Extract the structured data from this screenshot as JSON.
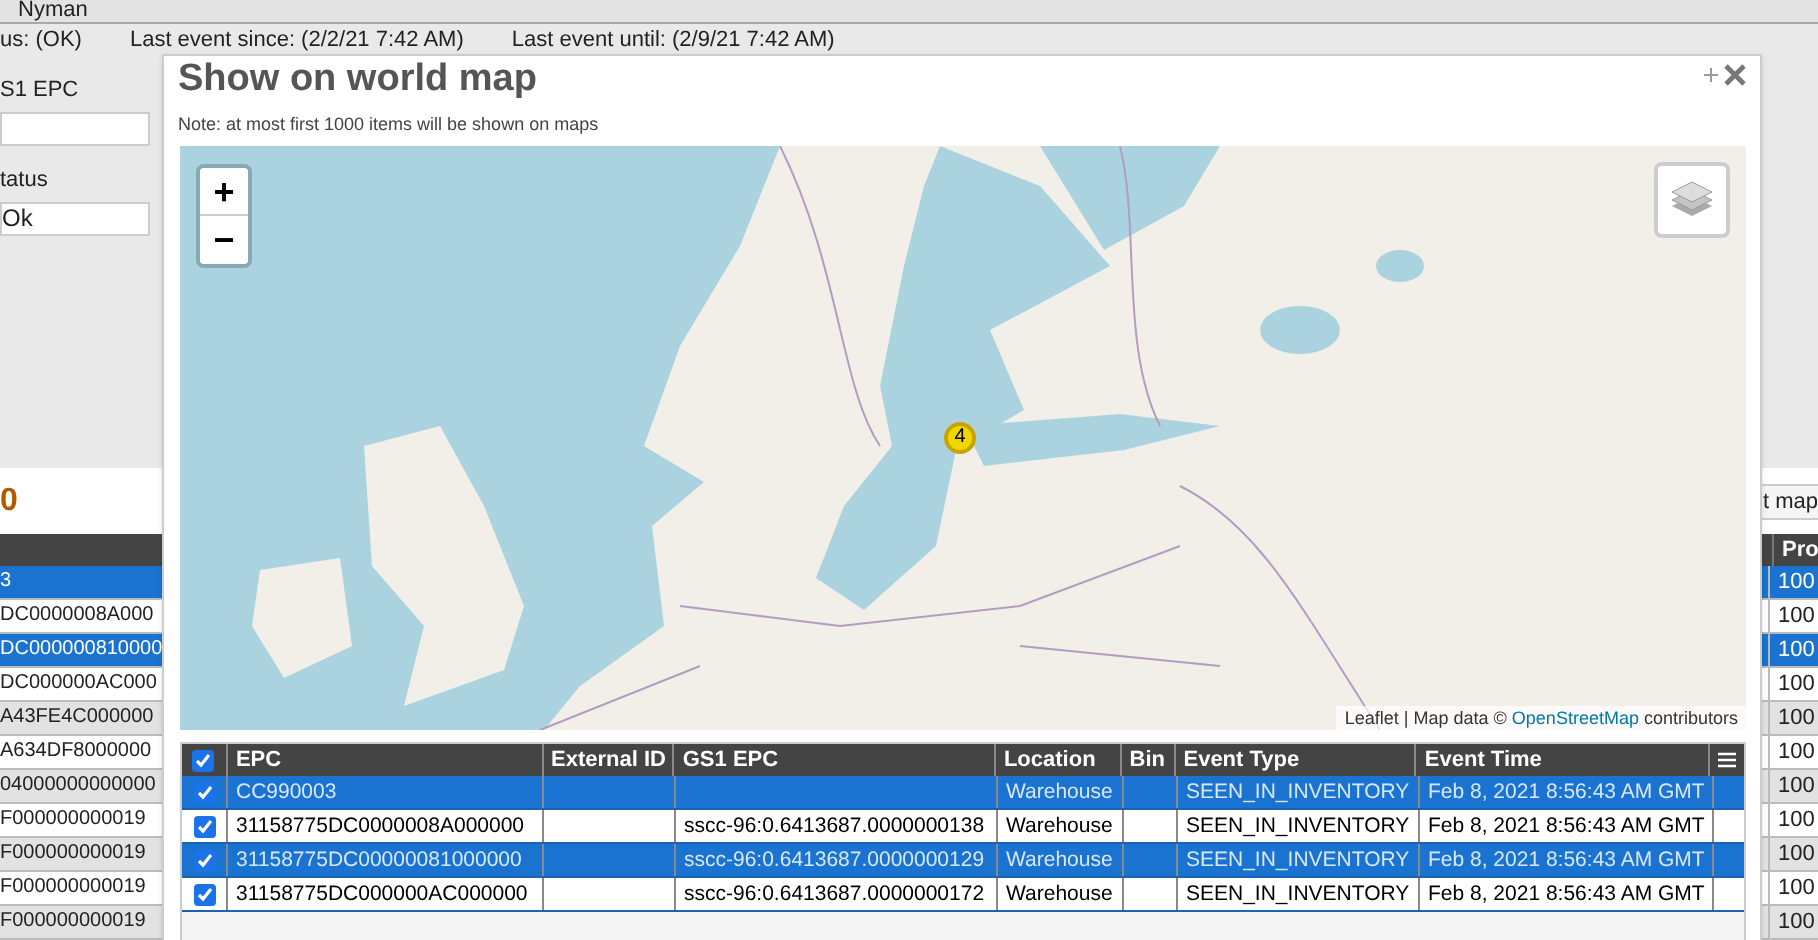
{
  "background": {
    "user": "Nyman",
    "status_line": [
      "us: (OK)",
      "Last event since: (2/2/21 7:42 AM)",
      "Last event until: (2/9/21 7:42 AM)"
    ],
    "filters": [
      {
        "label": "S1 EPC"
      },
      {
        "label": "tatus",
        "value": "Ok"
      }
    ],
    "count": "0",
    "map_button": "t map",
    "table": {
      "columns": [
        "Pro"
      ],
      "rows": [
        {
          "epc": "3",
          "product": "100",
          "selected": true
        },
        {
          "epc": "DC0000008A000",
          "product": "100",
          "selected": false
        },
        {
          "epc": "DC000000810000",
          "product": "100",
          "selected": true
        },
        {
          "epc": "DC000000AC000",
          "product": "100",
          "selected": false
        },
        {
          "epc": "A43FE4C000000",
          "product": "100",
          "selected": false
        },
        {
          "epc": "A634DF8000000",
          "product": "100",
          "selected": false
        },
        {
          "epc": "04000000000000",
          "product": "100",
          "selected": false
        },
        {
          "epc": "F000000000019",
          "product": "100",
          "selected": false
        },
        {
          "epc": "F000000000019",
          "product": "100",
          "selected": false
        },
        {
          "epc": "F000000000019",
          "product": "100",
          "selected": false
        },
        {
          "epc": "F000000000019",
          "product": "100",
          "selected": false
        }
      ]
    }
  },
  "dialog": {
    "title": "Show on world map",
    "note": "Note: at most first 1000 items will be shown on maps",
    "map": {
      "zoom_in": "+",
      "zoom_out": "−",
      "cluster_count": "4",
      "attribution": {
        "text": "Leaflet | Map data © ",
        "link": "OpenStreetMap",
        "suffix": " contributors"
      }
    },
    "table": {
      "all_checked": true,
      "columns": [
        "EPC",
        "External ID",
        "GS1 EPC",
        "Location",
        "Bin",
        "Event Type",
        "Event Time"
      ],
      "rows": [
        {
          "checked": true,
          "selected": true,
          "cells": [
            "CC990003",
            "",
            "",
            "Warehouse",
            "",
            "SEEN_IN_INVENTORY",
            "Feb 8, 2021 8:56:43 AM GMT"
          ]
        },
        {
          "checked": true,
          "selected": false,
          "cells": [
            "31158775DC0000008A000000",
            "",
            "sscc-96:0.6413687.0000000138",
            "Warehouse",
            "",
            "SEEN_IN_INVENTORY",
            "Feb 8, 2021 8:56:43 AM GMT"
          ]
        },
        {
          "checked": true,
          "selected": true,
          "cells": [
            "31158775DC00000081000000",
            "",
            "sscc-96:0.6413687.0000000129",
            "Warehouse",
            "",
            "SEEN_IN_INVENTORY",
            "Feb 8, 2021 8:56:43 AM GMT"
          ]
        },
        {
          "checked": true,
          "selected": false,
          "cells": [
            "31158775DC000000AC000000",
            "",
            "sscc-96:0.6413687.0000000172",
            "Warehouse",
            "",
            "SEEN_IN_INVENTORY",
            "Feb 8, 2021 8:56:43 AM GMT"
          ]
        }
      ]
    }
  }
}
